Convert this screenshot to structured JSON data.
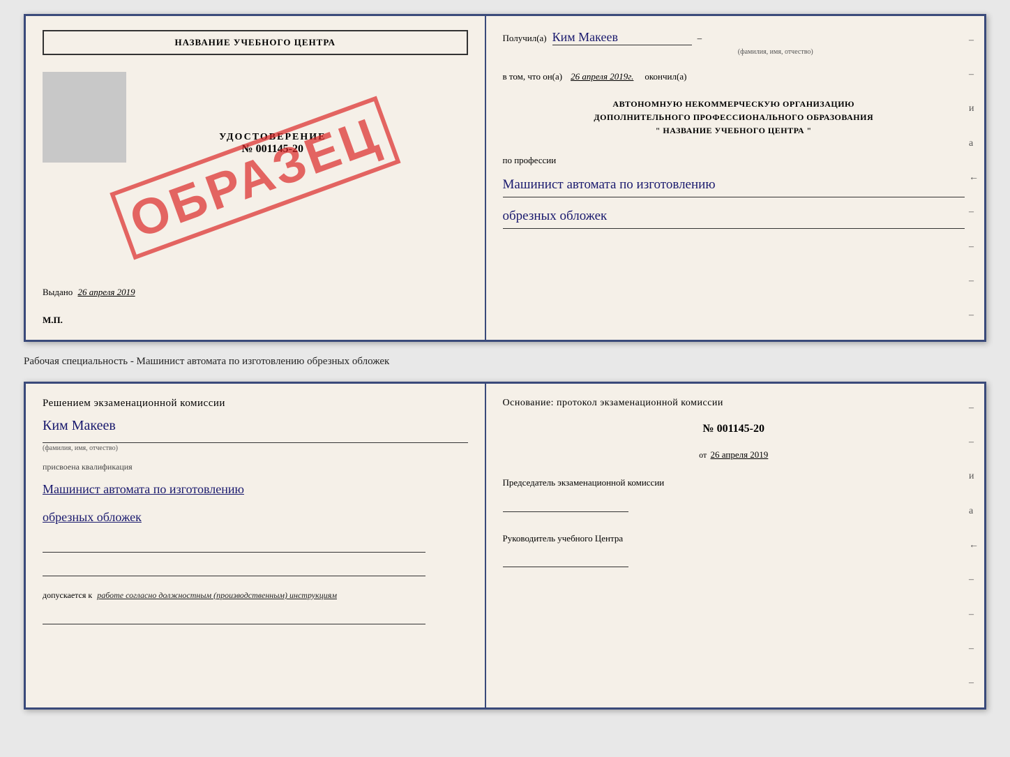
{
  "top_cert": {
    "left": {
      "school_name": "НАЗВАНИЕ УЧЕБНОГО ЦЕНТРА",
      "udostoverenie_label": "УДОСТОВЕРЕНИЕ",
      "number": "№ 001145-20",
      "vydano_label": "Выдано",
      "vydano_date": "26 апреля 2019",
      "mp_label": "М.П.",
      "stamp": "ОБРАЗЕЦ"
    },
    "right": {
      "poluchil_label": "Получил(а)",
      "recipient_name": "Ким Макеев",
      "fio_subtext": "(фамилия, имя, отчество)",
      "vtom_label": "в том, что он(а)",
      "date_value": "26 апреля 2019г.",
      "okonchil_label": "окончил(а)",
      "org_line1": "АВТОНОМНУЮ НЕКОММЕРЧЕСКУЮ ОРГАНИЗАЦИЮ",
      "org_line2": "ДОПОЛНИТЕЛЬНОГО ПРОФЕССИОНАЛЬНОГО ОБРАЗОВАНИЯ",
      "org_line3": "\"    НАЗВАНИЕ УЧЕБНОГО ЦЕНТРА    \"",
      "po_professii": "по профессии",
      "profession_line1": "Машинист автомата по изготовлению",
      "profession_line2": "обрезных обложек",
      "side_dashes": [
        "-",
        "-",
        "-",
        "и",
        "а",
        "←",
        "-",
        "-",
        "-",
        "-"
      ]
    }
  },
  "middle_caption": "Рабочая специальность - Машинист автомата по изготовлению обрезных обложек",
  "bottom_cert": {
    "left": {
      "resheniem_label": "Решением экзаменационной комиссии",
      "name": "Ким Макеев",
      "fio_subtext": "(фамилия, имя, отчество)",
      "prisvоena_label": "присвоена квалификация",
      "qualification_line1": "Машинист автомата по изготовлению",
      "qualification_line2": "обрезных обложек",
      "dopuskaetsya_label": "допускается к",
      "dopuskaetsya_value": "работе согласно должностным (производственным) инструкциям"
    },
    "right": {
      "osnov_label": "Основание: протокол экзаменационной комиссии",
      "protocol_number": "№  001145-20",
      "ot_label": "от",
      "protocol_date": "26 апреля 2019",
      "predsedatel_label": "Председатель экзаменационной комиссии",
      "rukovoditel_label": "Руководитель учебного Центра",
      "side_dashes": [
        "-",
        "-",
        "-",
        "и",
        "а",
        "←",
        "-",
        "-",
        "-",
        "-"
      ]
    }
  }
}
